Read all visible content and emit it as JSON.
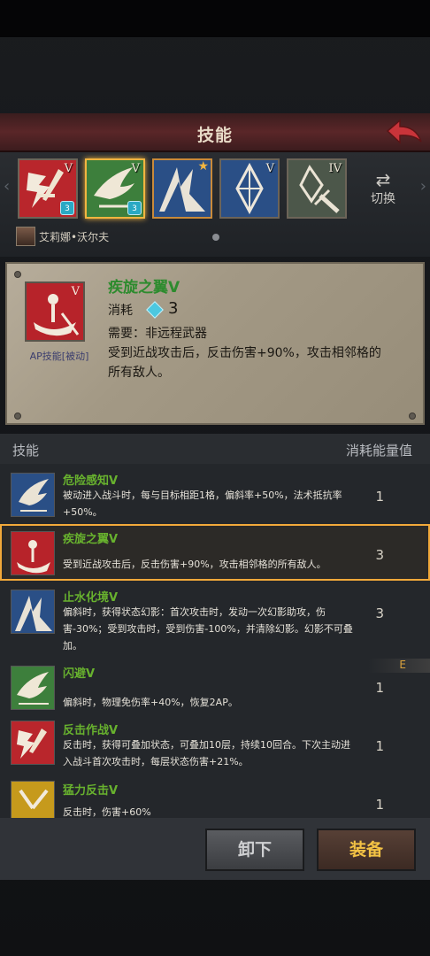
{
  "header": {
    "title": "技能",
    "back_icon": "back-arrow-icon"
  },
  "skill_slots": [
    {
      "name": "反击作战",
      "level": "V",
      "badge": "3",
      "color": "#b9262c",
      "icon": "counter-attack-icon",
      "selected": false,
      "starred": false
    },
    {
      "name": "疾旋之翼",
      "level": "V",
      "badge": "3",
      "color": "#3d7f3c",
      "icon": "wing-icon",
      "selected": true,
      "starred": false
    },
    {
      "name": "止水化境",
      "level": "",
      "badge": "",
      "color": "#2a4f86",
      "icon": "mirage-icon",
      "selected": false,
      "starred": true
    },
    {
      "name": "",
      "level": "V",
      "badge": "",
      "color": "#2a4f86",
      "icon": "crystal-icon",
      "selected": false,
      "starred": false
    },
    {
      "name": "",
      "level": "IV",
      "badge": "",
      "color": "#4c574a",
      "icon": "crystal-sword-icon",
      "selected": false,
      "starred": false
    }
  ],
  "switch": {
    "label": "切换",
    "icon": "swap-icon"
  },
  "character": {
    "name": "艾莉娜•沃尔夫"
  },
  "detail": {
    "title": "疾旋之翼V",
    "level": "V",
    "cost_label": "消耗",
    "cost_value": "3",
    "requirement": "需要：非远程武器",
    "description": "受到近战攻击后，反击伤害+90%，攻击相邻格的所有敌人。",
    "ap_label": "AP技能[被动]"
  },
  "list_header": {
    "left": "技能",
    "right": "消耗能量值"
  },
  "skills": [
    {
      "name": "危险感知V",
      "desc": "被动进入战斗时，每与目标相距1格，偏斜率+50%，法术抵抗率+50%。",
      "cost": "1",
      "color": "#2a4f86",
      "icon": "danger-sense-icon"
    },
    {
      "name": "疾旋之翼V",
      "desc": "受到近战攻击后，反击伤害+90%，攻击相邻格的所有敌人。",
      "cost": "3",
      "color": "#b9262c",
      "icon": "whirl-wing-icon"
    },
    {
      "name": "止水化境V",
      "desc": "偏斜时，获得状态幻影：首次攻击时，发动一次幻影助攻，伤害-30%；受到攻击时，受到伤害-100%，并清除幻影。幻影不可叠加。",
      "cost": "3",
      "color": "#2a4f86",
      "icon": "still-water-icon"
    },
    {
      "name": "闪避V",
      "desc": "偏斜时，物理免伤率+40%，恢复2AP。",
      "cost": "1",
      "color": "#3d7f3c",
      "icon": "evade-icon"
    },
    {
      "name": "反击作战V",
      "desc": "反击时，获得可叠加状态，可叠加10层，持续10回合。下次主动进入战斗首次攻击时，每层状态伤害+21%。",
      "cost": "1",
      "color": "#b9262c",
      "icon": "counter-attack-icon"
    },
    {
      "name": "猛力反击V",
      "desc": "反击时，伤害+60%",
      "cost": "1",
      "color": "#c69a1c",
      "icon": "fierce-counter-icon"
    }
  ],
  "e_tag": "E",
  "buttons": {
    "unequip": "卸下",
    "equip": "装备"
  }
}
